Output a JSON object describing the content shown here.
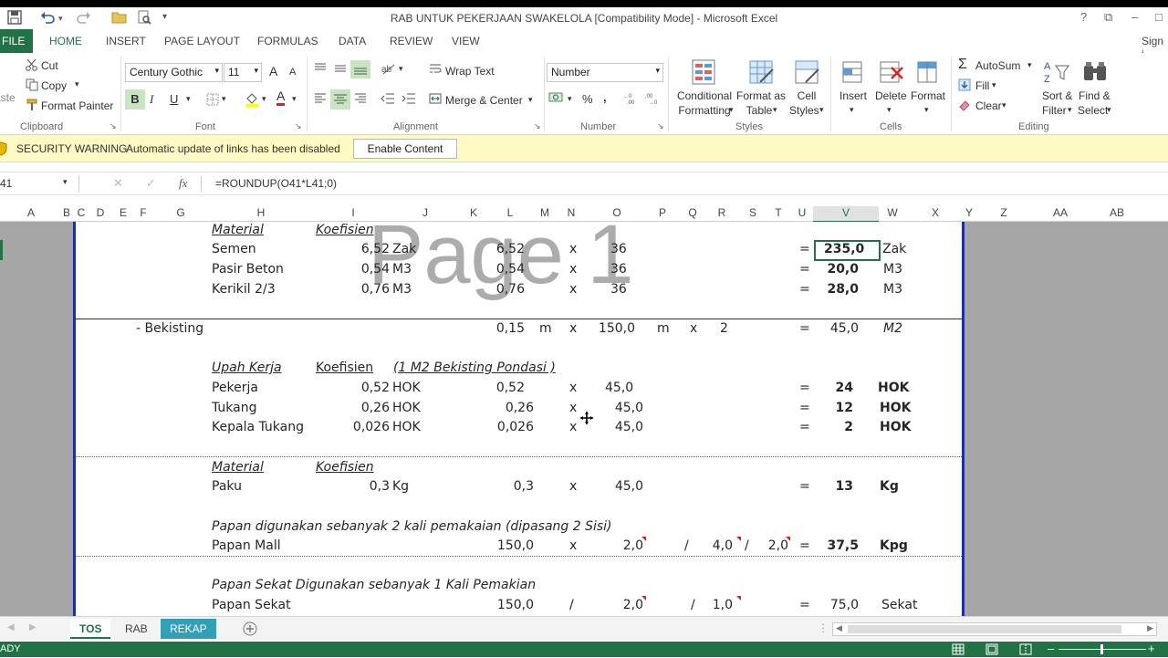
{
  "window": {
    "title": "RAB UNTUK PEKERJAAN SWAKELOLA  [Compatibility Mode] - Microsoft Excel",
    "help": "?",
    "restore": "⧉",
    "minimize": "–",
    "signin": "Sign i"
  },
  "ribbon_tabs": {
    "file": "FILE",
    "items": [
      "HOME",
      "INSERT",
      "PAGE LAYOUT",
      "FORMULAS",
      "DATA",
      "REVIEW",
      "VIEW"
    ]
  },
  "clipboard": {
    "cut": "Cut",
    "copy": "Copy",
    "format_painter": "Format Painter",
    "paste_partial": "aste",
    "group": "Clipboard"
  },
  "font": {
    "name": "Century Gothic",
    "size": "11",
    "grow": "A",
    "shrink": "A",
    "bold": "B",
    "italic": "I",
    "underline": "U",
    "font_color_letter": "A",
    "group": "Font"
  },
  "alignment": {
    "wrap": "Wrap Text",
    "merge": "Merge & Center",
    "group": "Alignment"
  },
  "number": {
    "format": "Number",
    "percent": "%",
    "comma": ",",
    "group": "Number"
  },
  "styles": {
    "conditional": [
      "Conditional",
      "Formatting"
    ],
    "format_as_table": [
      "Format as",
      "Table"
    ],
    "cell_styles": [
      "Cell",
      "Styles"
    ],
    "group": "Styles"
  },
  "cells": {
    "insert": "Insert",
    "delete": "Delete",
    "format": "Format",
    "group": "Cells"
  },
  "editing": {
    "autosum": "AutoSum",
    "fill": "Fill",
    "clear": "Clear",
    "sort": [
      "Sort &",
      "Filter"
    ],
    "find": [
      "Find &",
      "Select"
    ],
    "group": "Editing"
  },
  "security": {
    "label": "SECURITY WARNING",
    "message": "Automatic update of links has been disabled",
    "button": "Enable Content"
  },
  "formula_bar": {
    "name_box": "41",
    "fx": "fx",
    "formula": "=ROUNDUP(O41*L41;0)"
  },
  "columns": [
    "A",
    "B",
    "C",
    "D",
    "E",
    "F",
    "G",
    "H",
    "I",
    "J",
    "K",
    "L",
    "M",
    "N",
    "O",
    "P",
    "Q",
    "R",
    "S",
    "T",
    "U",
    "V",
    "W",
    "X",
    "Y",
    "Z",
    "AA",
    "AB"
  ],
  "watermark": "Page 1",
  "rows": {
    "material1_title": "Material",
    "koefisien1": "Koefisien",
    "semen": {
      "name": "Semen",
      "coef": "6,52",
      "unit": "Zak",
      "l": "6,52",
      "op": "x",
      "o": "36",
      "eq": "=",
      "v": "235,0",
      "w": "Zak"
    },
    "pasir": {
      "name": "Pasir Beton",
      "coef": "0,54",
      "unit": "M3",
      "l": "0,54",
      "op": "x",
      "o": "36",
      "eq": "=",
      "v": "20,0",
      "w": "M3"
    },
    "kerikil": {
      "name": "Kerikil 2/3",
      "coef": "0,76",
      "unit": "M3",
      "l": "0,76",
      "op": "x",
      "o": "36",
      "eq": "=",
      "v": "28,0",
      "w": "M3"
    },
    "bekisting": {
      "name": "- Bekisting",
      "l": "0,15",
      "m": "m",
      "op": "x",
      "o": "150,0",
      "p": "m",
      "op2": "x",
      "r": "2",
      "eq": "=",
      "v": "45,0",
      "w": "M2"
    },
    "upah_title": "Upah Kerja",
    "koefisien2": "Koefisien",
    "upah_note": "(1 M2 Bekisting Pondasi )",
    "pekerja": {
      "name": "Pekerja",
      "coef": "0,52",
      "unit": "HOK",
      "l": "0,52",
      "op": "x",
      "o": "45,0",
      "eq": "=",
      "v": "24",
      "w": "HOK"
    },
    "tukang": {
      "name": "Tukang",
      "coef": "0,26",
      "unit": "HOK",
      "l": "0,26",
      "op": "x",
      "o": "45,0",
      "eq": "=",
      "v": "12",
      "w": "HOK"
    },
    "kepala": {
      "name": "Kepala Tukang",
      "coef": "0,026",
      "unit": "HOK",
      "l": "0,026",
      "op": "x",
      "o": "45,0",
      "eq": "=",
      "v": "2",
      "w": "HOK"
    },
    "material2_title": "Material",
    "koefisien3": "Koefisien",
    "paku": {
      "name": "Paku",
      "coef": "0,3",
      "unit": "Kg",
      "l": "0,3",
      "op": "x",
      "o": "45,0",
      "eq": "=",
      "v": "13",
      "w": "Kg"
    },
    "papan_note": "Papan digunakan sebanyak 2 kali pemakaian (dipasang 2 Sisi)",
    "papan_mall": {
      "name": "Papan Mall",
      "l": "150,0",
      "op": "x",
      "o": "2,0",
      "op2": "/",
      "r": "4,0",
      "op3": "/",
      "t": "2,0",
      "eq": "=",
      "v": "37,5",
      "w": "Kpg"
    },
    "sekat_note": "Papan Sekat Digunakan sebanyak 1 Kali Pemakian",
    "papan_sekat": {
      "name": "Papan Sekat",
      "l": "150,0",
      "op": "/",
      "o": "2,0",
      "op2": "/",
      "r": "1,0",
      "eq": "=",
      "v": "75,0",
      "w": "Sekat"
    }
  },
  "sheet_tabs": [
    "TOS",
    "RAB",
    "REKAP"
  ],
  "status": {
    "text": "ADY"
  },
  "colors": {
    "excel_green": "#217346",
    "page_border": "#1f2f9f",
    "warning_bg": "#fff9c4"
  }
}
